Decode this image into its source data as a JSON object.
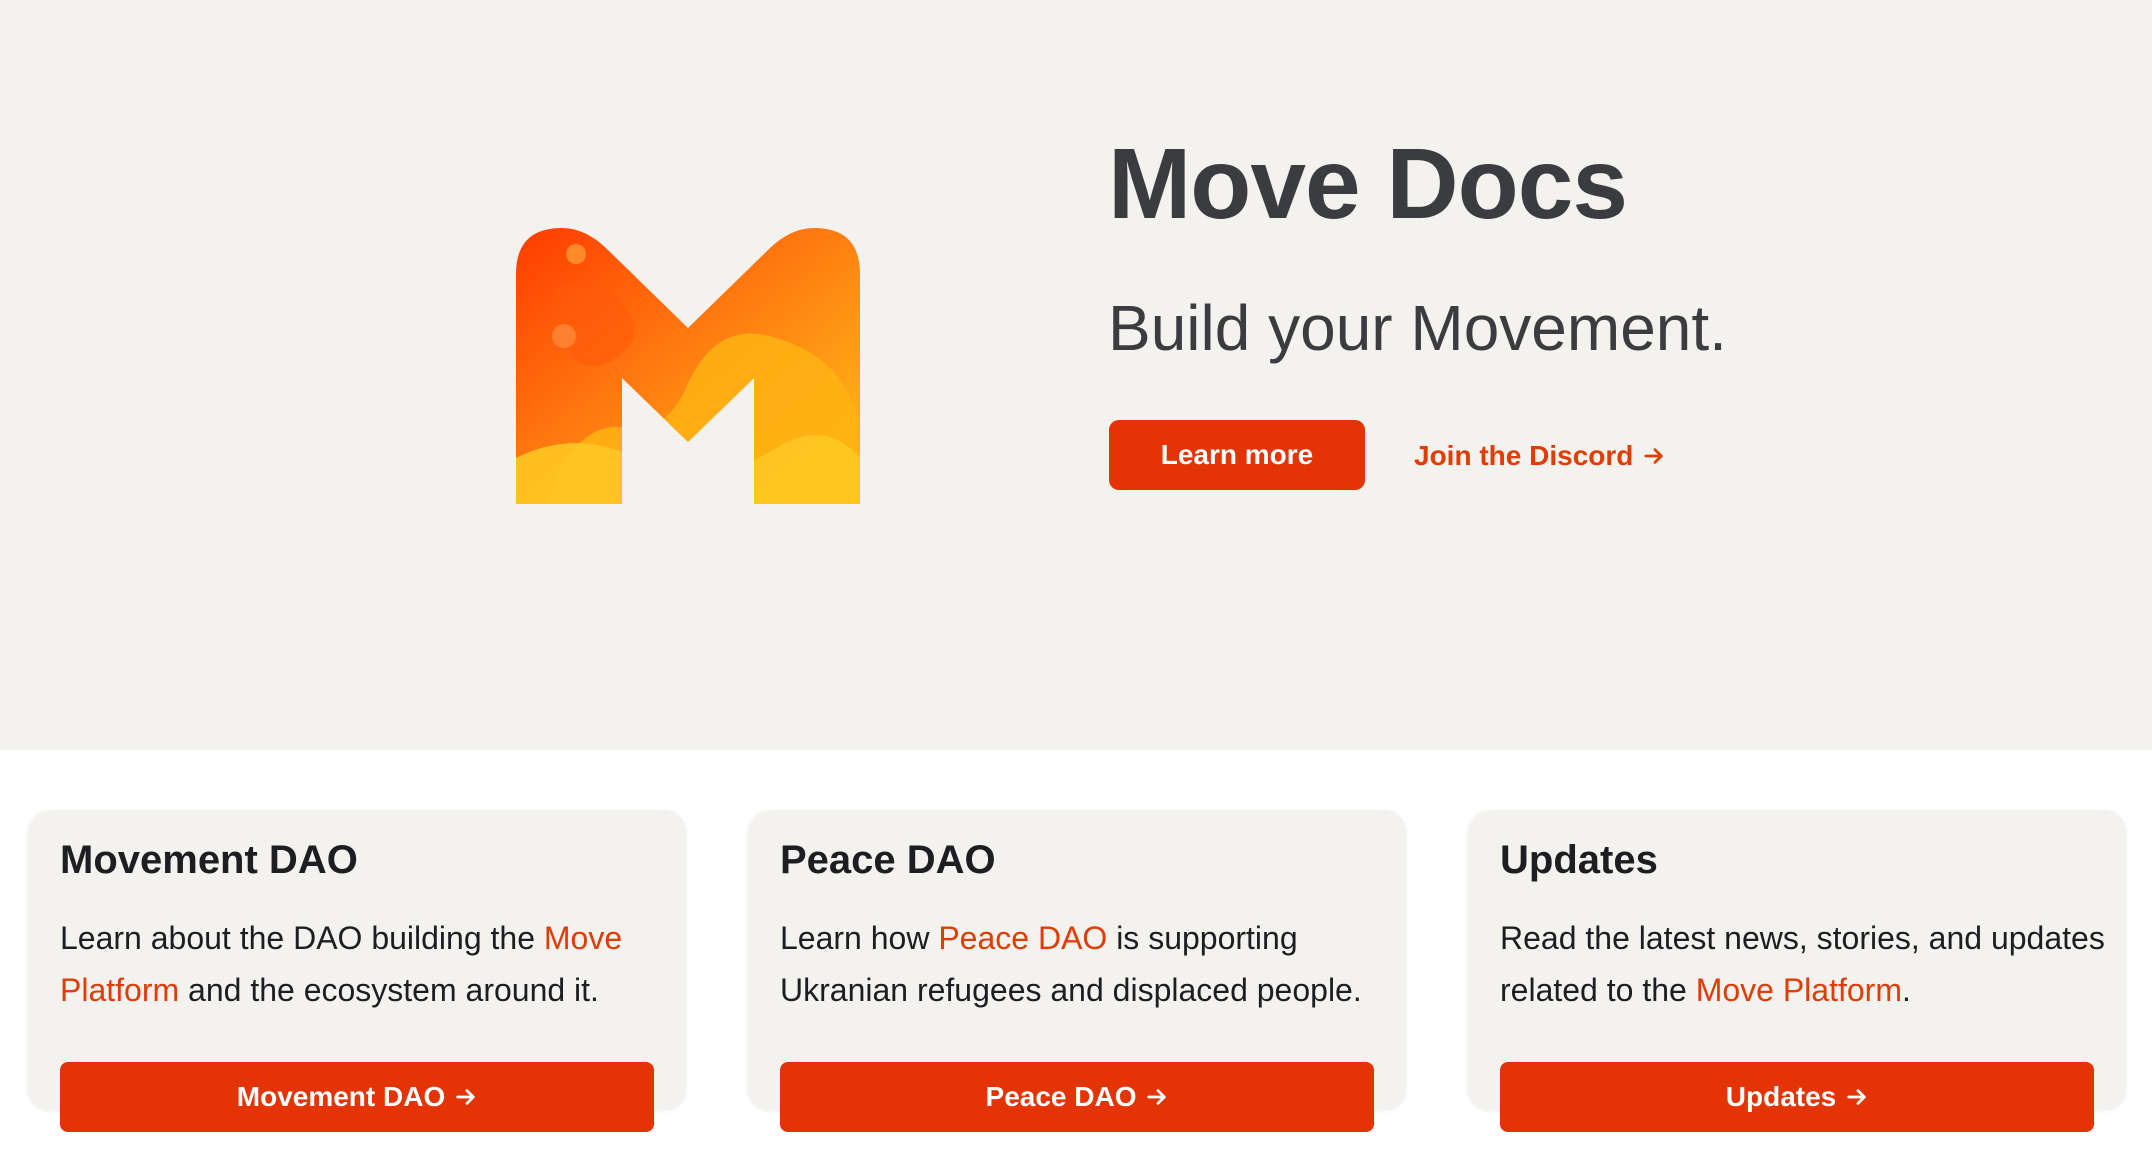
{
  "hero": {
    "title": "Move Docs",
    "subtitle": "Build your Movement.",
    "learn_more_label": "Learn more",
    "discord_label": "Join the Discord",
    "logo_icon": "movement-m-logo-icon"
  },
  "cards": [
    {
      "title": "Movement DAO",
      "desc_before": "Learn about the DAO building the ",
      "desc_link": "Move Platform",
      "desc_after": " and the ecosystem around it.",
      "button_label": "Movement DAO"
    },
    {
      "title": "Peace DAO",
      "desc_before": "Learn how ",
      "desc_link": "Peace DAO",
      "desc_after": " is supporting Ukranian refugees and displaced people.",
      "button_label": "Peace DAO"
    },
    {
      "title": "Updates",
      "desc_before": "Read the latest news, stories, and updates related to the ",
      "desc_link": "Move Platform",
      "desc_after": ".",
      "button_label": "Updates"
    }
  ],
  "colors": {
    "accent": "#e43405",
    "link": "#e03c06",
    "hero_bg": "#f3f2ef",
    "card_bg": "#f3f2ef",
    "heading": "#3b3c40"
  }
}
